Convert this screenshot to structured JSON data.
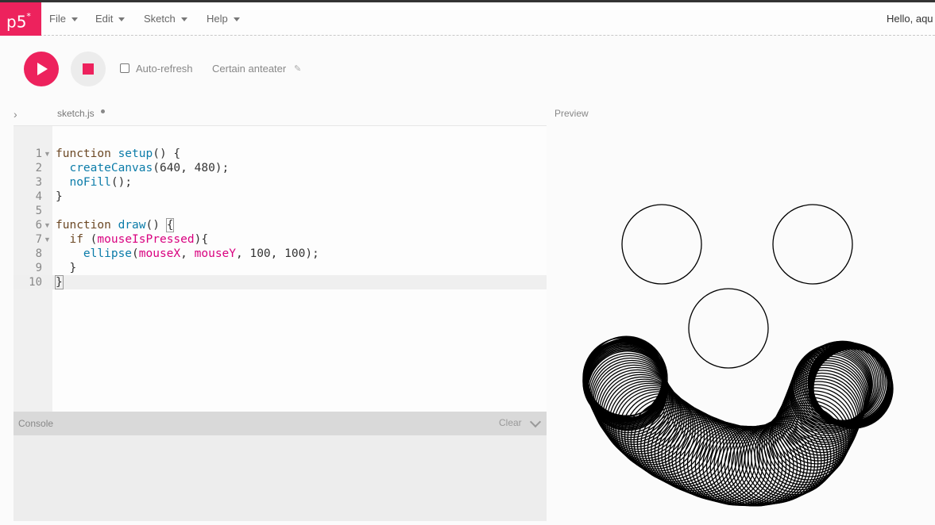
{
  "nav": {
    "logo": "p5",
    "logo_sup": "*",
    "menus": [
      "File",
      "Edit",
      "Sketch",
      "Help"
    ],
    "greeting": "Hello, aqu"
  },
  "toolbar": {
    "play_icon": "play-icon",
    "stop_icon": "stop-icon",
    "auto_refresh_label": "Auto-refresh",
    "auto_refresh_checked": false,
    "project_name": "Certain anteater",
    "edit_icon": "pencil-icon"
  },
  "editor": {
    "file_tab": "sketch.js",
    "unsaved": true,
    "line_numbers": [
      "1",
      "2",
      "3",
      "4",
      "5",
      "6",
      "7",
      "8",
      "9",
      "10"
    ],
    "lines": [
      "function setup() {",
      "  createCanvas(640, 480);",
      "  noFill();",
      "}",
      "",
      "function draw() {",
      "  if (mouseIsPressed){",
      "    ellipse(mouseX, mouseY, 100, 100);",
      "  }",
      "}"
    ]
  },
  "console": {
    "label": "Console",
    "clear_label": "Clear"
  },
  "preview": {
    "label": "Preview"
  },
  "colors": {
    "accent": "#ed225d",
    "keyword": "#6b4723",
    "function": "#0b7ca9",
    "variable": "#d9007f"
  }
}
